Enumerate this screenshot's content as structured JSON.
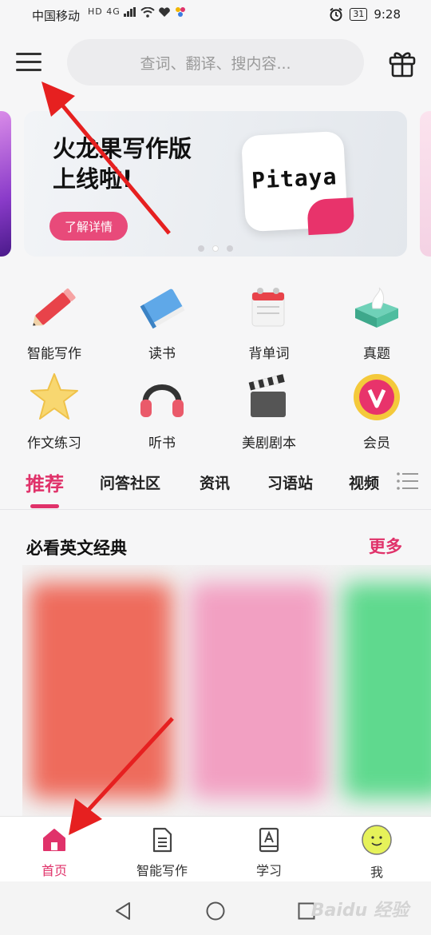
{
  "status_bar": {
    "carrier": "中国移动",
    "network_badges": "HD 4G",
    "battery": "31",
    "time": "9:28"
  },
  "header": {
    "search_placeholder": "查词、翻译、搜内容..."
  },
  "banner": {
    "title": "火龙果写作版\n上线啦!",
    "button": "了解详情",
    "logo_text": "Pitaya",
    "slide_count": 3,
    "active_slide": 2
  },
  "features": [
    {
      "label": "智能写作",
      "icon": "pencil-icon"
    },
    {
      "label": "读书",
      "icon": "book-icon"
    },
    {
      "label": "背单词",
      "icon": "calendar-icon"
    },
    {
      "label": "真题",
      "icon": "tissue-box-icon"
    },
    {
      "label": "作文练习",
      "icon": "star-icon"
    },
    {
      "label": "听书",
      "icon": "headphones-icon"
    },
    {
      "label": "美剧剧本",
      "icon": "clapperboard-icon"
    },
    {
      "label": "会员",
      "icon": "vip-medal-icon"
    }
  ],
  "tabs": [
    {
      "label": "推荐",
      "active": true
    },
    {
      "label": "问答社区",
      "active": false
    },
    {
      "label": "资讯",
      "active": false
    },
    {
      "label": "习语站",
      "active": false
    },
    {
      "label": "视频",
      "active": false
    }
  ],
  "section": {
    "title": "必看英文经典",
    "more": "更多"
  },
  "books": [
    {
      "color": "#ee6b5c"
    },
    {
      "color": "#f2a0c2"
    },
    {
      "color": "#5fd98e"
    }
  ],
  "bottom_nav": [
    {
      "label": "首页",
      "icon": "home-icon",
      "active": true
    },
    {
      "label": "智能写作",
      "icon": "document-icon",
      "active": false
    },
    {
      "label": "学习",
      "icon": "study-book-icon",
      "active": false
    },
    {
      "label": "我",
      "icon": "avatar-icon",
      "active": false
    }
  ],
  "system_nav": [
    "back-icon",
    "home-circle-icon",
    "recents-icon"
  ],
  "watermark": "Baidu 经验",
  "colors": {
    "accent": "#e0326a",
    "banner_button": "#e84a7a",
    "annotation_arrow": "#e62020"
  }
}
